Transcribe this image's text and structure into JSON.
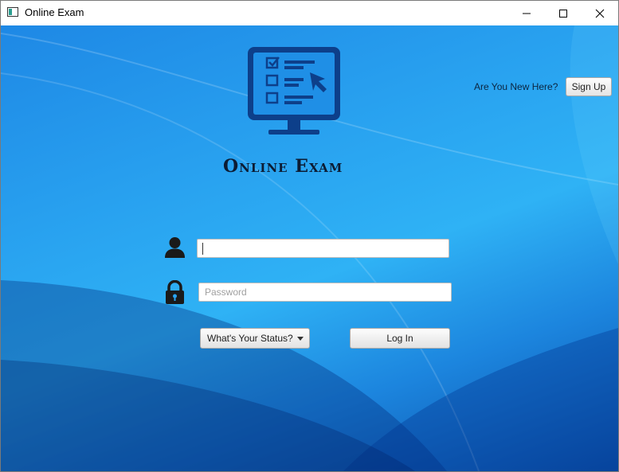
{
  "window": {
    "title": "Online Exam",
    "controls": [
      "minimize-icon",
      "maximize-icon",
      "close-icon"
    ]
  },
  "brand": {
    "title": "Online Exam",
    "logo_icon": "exam-monitor-icon"
  },
  "signup": {
    "question": "Are You New Here?",
    "button_label": "Sign Up"
  },
  "login_form": {
    "username": {
      "value": "",
      "placeholder": "",
      "icon": "user-icon"
    },
    "password": {
      "value": "",
      "placeholder": "Password",
      "icon": "lock-icon"
    },
    "status_dropdown": {
      "selected": "What's Your Status?",
      "icon": "chevron-down-icon"
    },
    "login_button": "Log In"
  },
  "colors": {
    "background": "#29a3f0",
    "logo": "#0d3f8a",
    "brand_text": "#0c1c33"
  }
}
